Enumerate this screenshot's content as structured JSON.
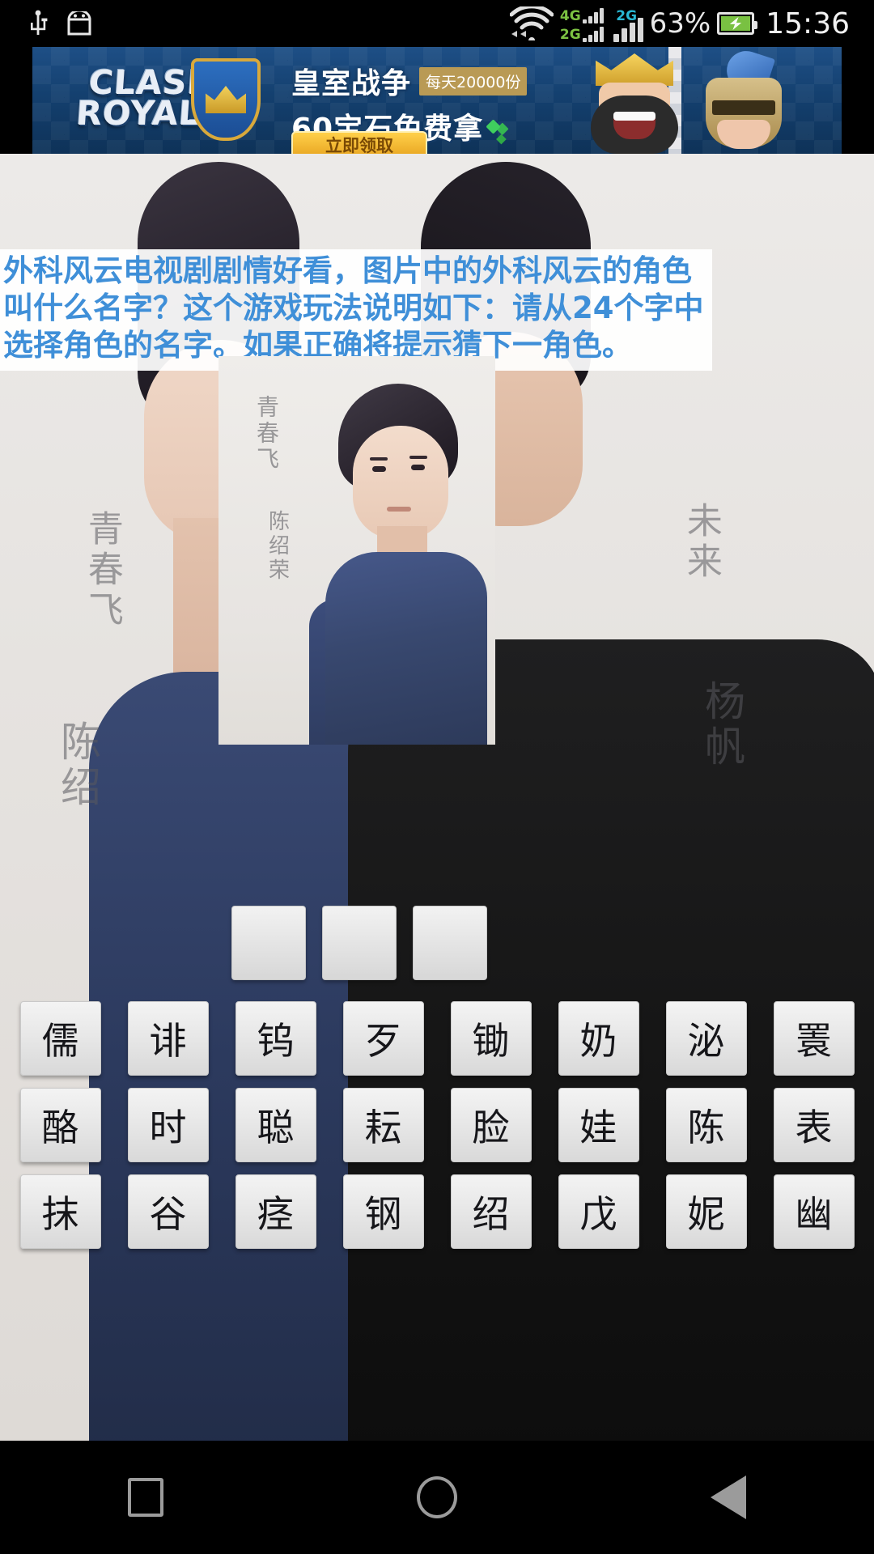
{
  "status_bar": {
    "icons": [
      "usb-icon",
      "android-debug-icon",
      "wifi-icon"
    ],
    "sim1_label_top": "4G",
    "sim1_label_bottom": "2G",
    "sim2_label": "2G",
    "battery_percent": "63%",
    "clock": "15:36"
  },
  "ad": {
    "logo_line1": "CLASH",
    "logo_line2": "ROYALE",
    "title": "皇室战争",
    "tag": "每天20000份",
    "subtitle": "60宝石免费拿",
    "cta": "立即领取"
  },
  "question": {
    "text": "外科风云电视剧剧情好看，图片中的外科风云的角色叫什么名字？这个游戏玩法说明如下：请从24个字中选择角色的名字。如果正确将提示猜下一角色。",
    "color": "#3f8fd8"
  },
  "photo": {
    "calligraphy_left": "青春飞",
    "calligraphy_left_2": "陈绍",
    "calligraphy_right": "未来",
    "calligraphy_right_2": "杨帆",
    "inset_calligraphy": "青春飞",
    "inset_calligraphy_2": "陈绍荣"
  },
  "answer_slots": {
    "count": 3,
    "values": [
      "",
      "",
      ""
    ]
  },
  "char_grid": {
    "rows": [
      [
        "儒",
        "诽",
        "钨",
        "歹",
        "锄",
        "奶",
        "泌",
        "瞏"
      ],
      [
        "酪",
        "时",
        "聪",
        "耘",
        "脸",
        "娃",
        "陈",
        "表"
      ],
      [
        "抹",
        "谷",
        "痉",
        "钢",
        "绍",
        "戊",
        "妮",
        "幽"
      ]
    ]
  },
  "nav_bar": {
    "recents_label": "recents",
    "home_label": "home",
    "back_label": "back"
  }
}
